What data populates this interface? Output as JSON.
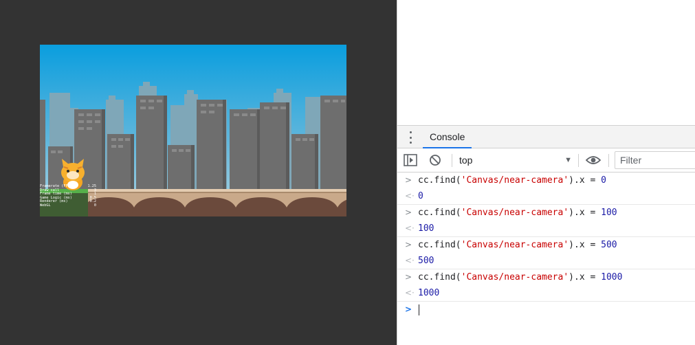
{
  "game": {
    "stats": [
      {
        "label": "Framerate (FPS)",
        "value": "1.25"
      },
      {
        "label": "Draw call",
        "value": "3"
      },
      {
        "label": "Frame time (ms)",
        "value": "1"
      },
      {
        "label": "Game Logic (ms)",
        "value": "0.5"
      },
      {
        "label": "Renderer (ms)",
        "value": "0.2"
      },
      {
        "label": "WebGL",
        "value": "0"
      }
    ],
    "colors": {
      "sky_top": "#0a9ede",
      "sky_bottom": "#aed3e1",
      "building_far": "#7fa7b8",
      "building_near": "#6e6e6e",
      "bridge": "#c9a98a",
      "arch": "#6b4a3c",
      "grass": "#56b04a"
    }
  },
  "devtools": {
    "tab_label": "Console",
    "context": "top",
    "filter_placeholder": "Filter",
    "entries": [
      {
        "target": "'Canvas/near-camera'",
        "value_in": "0",
        "result": "0"
      },
      {
        "target": "'Canvas/near-camera'",
        "value_in": "100",
        "result": "100"
      },
      {
        "target": "'Canvas/near-camera'",
        "value_in": "500",
        "result": "500"
      },
      {
        "target": "'Canvas/near-camera'",
        "value_in": "1000",
        "result": "1000"
      }
    ],
    "code_prefix": "cc.find(",
    "code_suffix": ").x",
    "code_op": "=",
    "icons": {
      "menu": "kebab-menu-icon",
      "sidebar": "sidebar-toggle-icon",
      "clear": "clear-console-icon",
      "dropdown": "triangle-down-icon",
      "eye": "eye-icon"
    }
  }
}
